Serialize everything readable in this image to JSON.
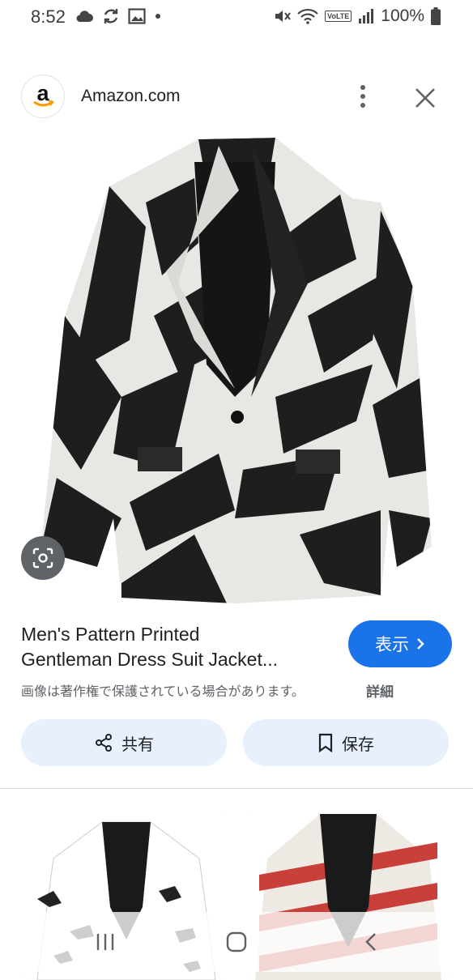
{
  "status_bar": {
    "time": "8:52",
    "left_icons": [
      "cloud-icon",
      "sync-icon",
      "image-icon",
      "dot-icon"
    ],
    "right_icons": [
      "mute-icon",
      "wifi-icon",
      "volte-icon",
      "signal-icon"
    ],
    "volte_label": "VoLTE",
    "battery": "100%"
  },
  "source": {
    "logo_letter": "a",
    "name": "Amazon.com"
  },
  "product": {
    "image_desc_icon": "jacket-image",
    "title_line1": "Men's Pattern Printed",
    "title_line2": "Gentleman Dress Suit Jacket...",
    "view_label": "表示",
    "copyright": "画像は著作権で保護されている場合があります。",
    "details_label": "詳細"
  },
  "actions": {
    "share_label": "共有",
    "save_label": "保存"
  },
  "colors": {
    "accent_blue": "#1a73e8",
    "button_bg": "#e8f0fe",
    "muted_text": "#5f6368"
  }
}
